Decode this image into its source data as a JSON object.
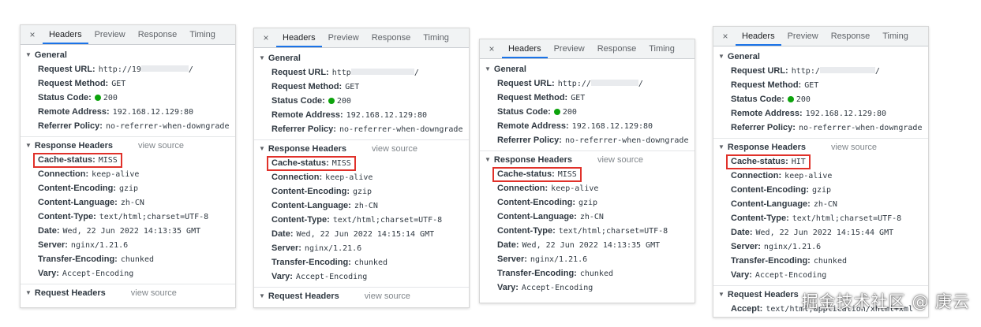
{
  "tabs": [
    "Headers",
    "Preview",
    "Response",
    "Timing"
  ],
  "close_glyph": "×",
  "general_title": "General",
  "response_headers_title": "Response Headers",
  "request_headers_title": "Request Headers",
  "view_source": "view source",
  "colors": {
    "highlight": "#e0312a",
    "status_ok": "#0ca30c",
    "tab_accent": "#1a73e8"
  },
  "panels": [
    {
      "general": {
        "request_url_label": "Request URL:",
        "request_url_pre": "http://19",
        "request_url_post": "/",
        "method_label": "Request Method:",
        "method": "GET",
        "status_label": "Status Code:",
        "status": "200",
        "remote_label": "Remote Address:",
        "remote": "192.168.12.129:80",
        "referrer_label": "Referrer Policy:",
        "referrer": "no-referrer-when-downgrade"
      },
      "response": {
        "cache_label": "Cache-status:",
        "cache": "MISS",
        "connection_label": "Connection:",
        "connection": "keep-alive",
        "encoding_label": "Content-Encoding:",
        "encoding": "gzip",
        "language_label": "Content-Language:",
        "language": "zh-CN",
        "type_label": "Content-Type:",
        "type": "text/html;charset=UTF-8",
        "date_label": "Date:",
        "date": "Wed, 22 Jun 2022 14:13:35 GMT",
        "server_label": "Server:",
        "server": "nginx/1.21.6",
        "transfer_label": "Transfer-Encoding:",
        "transfer": "chunked",
        "vary_label": "Vary:",
        "vary": "Accept-Encoding"
      }
    },
    {
      "general": {
        "request_url_label": "Request URL:",
        "request_url_pre": "http",
        "request_url_post": "/",
        "method_label": "Request Method:",
        "method": "GET",
        "status_label": "Status Code:",
        "status": "200",
        "remote_label": "Remote Address:",
        "remote": "192.168.12.129:80",
        "referrer_label": "Referrer Policy:",
        "referrer": "no-referrer-when-downgrade"
      },
      "response": {
        "cache_label": "Cache-status:",
        "cache": "MISS",
        "connection_label": "Connection:",
        "connection": "keep-alive",
        "encoding_label": "Content-Encoding:",
        "encoding": "gzip",
        "language_label": "Content-Language:",
        "language": "zh-CN",
        "type_label": "Content-Type:",
        "type": "text/html;charset=UTF-8",
        "date_label": "Date:",
        "date": "Wed, 22 Jun 2022 14:15:14 GMT",
        "server_label": "Server:",
        "server": "nginx/1.21.6",
        "transfer_label": "Transfer-Encoding:",
        "transfer": "chunked",
        "vary_label": "Vary:",
        "vary": "Accept-Encoding"
      }
    },
    {
      "general": {
        "request_url_label": "Request URL:",
        "request_url_pre": "http://",
        "request_url_post": "/",
        "method_label": "Request Method:",
        "method": "GET",
        "status_label": "Status Code:",
        "status": "200",
        "remote_label": "Remote Address:",
        "remote": "192.168.12.129:80",
        "referrer_label": "Referrer Policy:",
        "referrer": "no-referrer-when-downgrade"
      },
      "response": {
        "cache_label": "Cache-status:",
        "cache": "MISS",
        "connection_label": "Connection:",
        "connection": "keep-alive",
        "encoding_label": "Content-Encoding:",
        "encoding": "gzip",
        "language_label": "Content-Language:",
        "language": "zh-CN",
        "type_label": "Content-Type:",
        "type": "text/html;charset=UTF-8",
        "date_label": "Date:",
        "date": "Wed, 22 Jun 2022 14:13:35 GMT",
        "server_label": "Server:",
        "server": "nginx/1.21.6",
        "transfer_label": "Transfer-Encoding:",
        "transfer": "chunked",
        "vary_label": "Vary:",
        "vary": "Accept-Encoding"
      }
    },
    {
      "general": {
        "request_url_label": "Request URL:",
        "request_url_pre": "http:/",
        "request_url_post": "/",
        "method_label": "Request Method:",
        "method": "GET",
        "status_label": "Status Code:",
        "status": "200",
        "remote_label": "Remote Address:",
        "remote": "192.168.12.129:80",
        "referrer_label": "Referrer Policy:",
        "referrer": "no-referrer-when-downgrade"
      },
      "response": {
        "cache_label": "Cache-status:",
        "cache": "HIT",
        "connection_label": "Connection:",
        "connection": "keep-alive",
        "encoding_label": "Content-Encoding:",
        "encoding": "gzip",
        "language_label": "Content-Language:",
        "language": "zh-CN",
        "type_label": "Content-Type:",
        "type": "text/html;charset=UTF-8",
        "date_label": "Date:",
        "date": "Wed, 22 Jun 2022 14:15:44 GMT",
        "server_label": "Server:",
        "server": "nginx/1.21.6",
        "transfer_label": "Transfer-Encoding:",
        "transfer": "chunked",
        "vary_label": "Vary:",
        "vary": "Accept-Encoding"
      },
      "request_extra_label": "Accept:",
      "request_extra_value": "text/html,application/xhtml+xml"
    }
  ],
  "watermark": "掘金技术社区 @ 庚云"
}
